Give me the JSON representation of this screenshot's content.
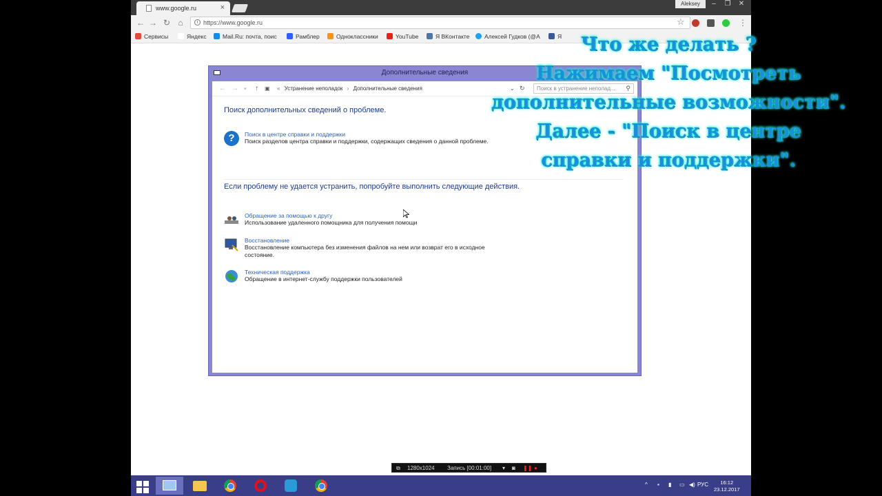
{
  "browser": {
    "tab_title": "www.google.ru",
    "user": "Aleksey",
    "address": "https://www.google.ru",
    "bookmarks": [
      "Сервисы",
      "Яндекс",
      "Mail.Ru: почта, поис",
      "Рамблер",
      "Одноклассники",
      "YouTube",
      "Я ВКонтакте",
      "Алексей Гудков (@А",
      "Я"
    ]
  },
  "dialog": {
    "title": "Дополнительные сведения",
    "breadcrumb": [
      "Устранение неполадок",
      "Дополнительные сведения"
    ],
    "search_placeholder": "Поиск в устранение неполад...",
    "heading1": "Поиск дополнительных сведений о проблеме.",
    "help_link": "Поиск в центре справки и поддержки",
    "help_desc": "Поиск разделов центра справки и поддержки, содержащих сведения о данной проблеме.",
    "heading2": "Если проблему не удается устранить, попробуйте выполнить следующие действия.",
    "items": [
      {
        "link": "Обращение за помощью к другу",
        "desc": "Использование удаленного помощника для получения помощи"
      },
      {
        "link": "Восстановление",
        "desc": "Восстановление компьютера без изменения файлов на нем или возврат его в исходное состояние."
      },
      {
        "link": "Техническая поддержка",
        "desc": "Обращение в интернет-службу поддержки пользователей"
      }
    ]
  },
  "recorder": {
    "resolution": "1280x1024",
    "status": "Запись [00:01:00]"
  },
  "taskbar": {
    "language": "РУС",
    "time": "16:12",
    "date": "23.12.2017"
  },
  "caption": [
    "Что же делать ?",
    "Нажимаем \"Посмотреть",
    "дополнительные возможности\".",
    "Далее - \"Поиск в центре",
    "справки и поддержки\"."
  ],
  "colors": {
    "taskbar": "#3a3d87",
    "dialog_frame": "#8a87d2",
    "link": "#2c61b8",
    "heading": "#1e3a8a",
    "caption": "#1d8fd8"
  }
}
